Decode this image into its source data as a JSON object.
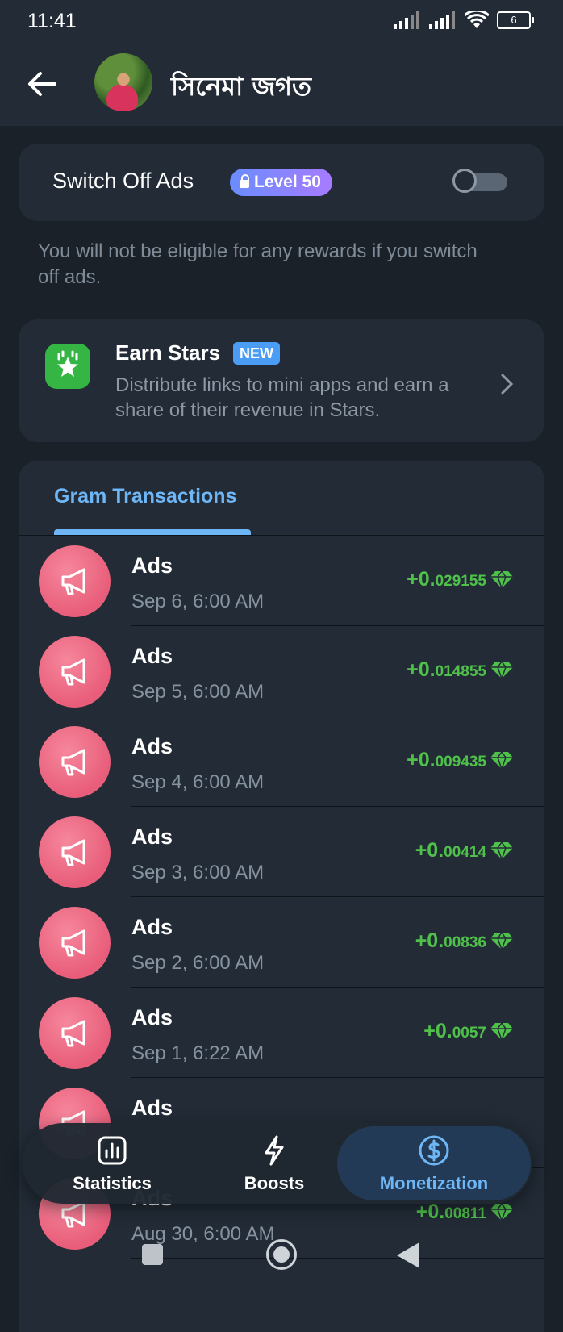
{
  "status_bar": {
    "time": "11:41",
    "battery": "6"
  },
  "header": {
    "title": "সিনেমা জগত"
  },
  "ads_toggle": {
    "label": "Switch Off Ads",
    "level_badge": "Level 50",
    "enabled": false
  },
  "ads_note": "You will not be eligible for any rewards if you switch off ads.",
  "earn_stars": {
    "title": "Earn Stars",
    "badge": "NEW",
    "description": "Distribute links to mini apps and earn a share of their revenue in Stars."
  },
  "transactions": {
    "tab_label": "Gram Transactions",
    "rows": [
      {
        "name": "Ads",
        "date": "Sep 6, 6:00 AM",
        "amount_main": "+0.",
        "amount_frac": "029155"
      },
      {
        "name": "Ads",
        "date": "Sep 5, 6:00 AM",
        "amount_main": "+0.",
        "amount_frac": "014855"
      },
      {
        "name": "Ads",
        "date": "Sep 4, 6:00 AM",
        "amount_main": "+0.",
        "amount_frac": "009435"
      },
      {
        "name": "Ads",
        "date": "Sep 3, 6:00 AM",
        "amount_main": "+0.",
        "amount_frac": "00414"
      },
      {
        "name": "Ads",
        "date": "Sep 2, 6:00 AM",
        "amount_main": "+0.",
        "amount_frac": "00836"
      },
      {
        "name": "Ads",
        "date": "Sep 1, 6:22 AM",
        "amount_main": "+0.",
        "amount_frac": "0057"
      },
      {
        "name": "Ads",
        "date": "",
        "amount_main": "",
        "amount_frac": ""
      },
      {
        "name": "Ads",
        "date": "Aug 30, 6:00 AM",
        "amount_main": "+0.",
        "amount_frac": "00811"
      }
    ]
  },
  "bottom_nav": {
    "statistics": "Statistics",
    "boosts": "Boosts",
    "monetization": "Monetization"
  },
  "colors": {
    "accent": "#6eb6f5",
    "positive": "#4fc14a",
    "ad_icon": "#e85d7a"
  }
}
